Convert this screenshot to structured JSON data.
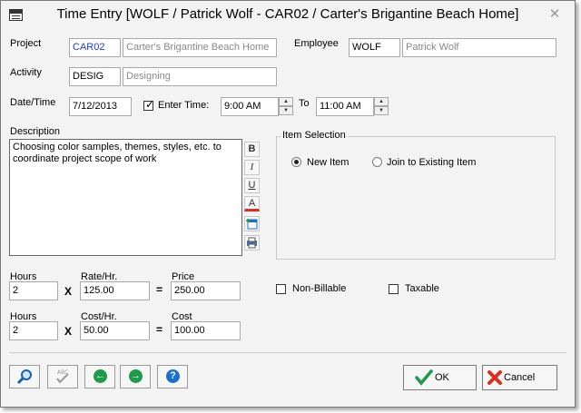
{
  "window": {
    "title": "Time Entry [WOLF / Patrick Wolf - CAR02 / Carter's Brigantine Beach Home]",
    "close_icon": "close-icon"
  },
  "project": {
    "label": "Project",
    "code": "CAR02",
    "name": "Carter's Brigantine Beach Home"
  },
  "employee": {
    "label": "Employee",
    "code": "WOLF",
    "name": "Patrick Wolf"
  },
  "activity": {
    "label": "Activity",
    "code": "DESIG",
    "name": "Designing"
  },
  "datetime": {
    "label": "Date/Time",
    "date": "7/12/2013",
    "enter_time_label": "Enter Time:",
    "enter_time_checked": true,
    "start": "9:00 AM",
    "to_label": "To",
    "end": "11:00 AM"
  },
  "description": {
    "label": "Description",
    "text": "Choosing color samples, themes, styles, etc. to coordinate project scope of work"
  },
  "format_tools": {
    "bold": "B",
    "italic": "I",
    "underline": "U",
    "font_color": "A"
  },
  "item_selection": {
    "label": "Item Selection",
    "new_item": "New Item",
    "join_existing": "Join to Existing Item",
    "selected": "new_item"
  },
  "billing": {
    "hours_label": "Hours",
    "hours": "2",
    "rate_label": "Rate/Hr.",
    "rate": "125.00",
    "price_label": "Price",
    "price": "250.00",
    "x": "X",
    "eq": "="
  },
  "cost": {
    "hours_label": "Hours",
    "hours": "2",
    "cost_hr_label": "Cost/Hr.",
    "cost_hr": "50.00",
    "cost_label": "Cost",
    "cost": "100.00"
  },
  "flags": {
    "non_billable": "Non-Billable",
    "non_billable_checked": false,
    "taxable": "Taxable",
    "taxable_checked": false
  },
  "buttons": {
    "ok": "OK",
    "cancel": "Cancel"
  },
  "colors": {
    "accent_blue": "#1a3cc6",
    "green": "#1e9a4a",
    "help_blue": "#1a6fd1",
    "cancel_red": "#d93025"
  }
}
